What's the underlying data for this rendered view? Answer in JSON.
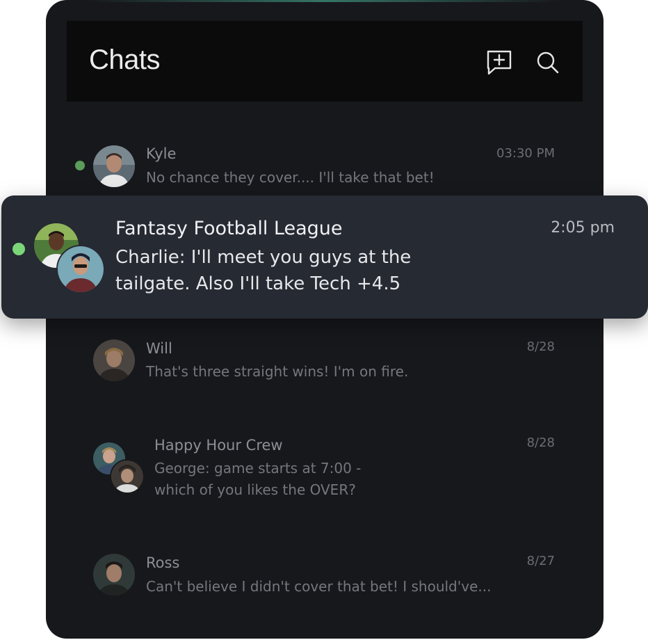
{
  "header": {
    "title": "Chats",
    "icons": [
      "new-chat-icon",
      "search-icon"
    ]
  },
  "chats": [
    {
      "name": "Kyle",
      "message": "No chance they cover....  I'll take that bet!",
      "time": "03:30 PM",
      "online": true
    },
    {
      "name": "Fantasy Football League",
      "message": "Charlie: I'll meet you guys at the\ntailgate. Also I'll take Tech +4.5",
      "time": "2:05 pm",
      "online": true,
      "highlighted": true
    },
    {
      "name": "Will",
      "message": "That's three straight wins!  I'm on fire.",
      "time": "8/28",
      "online": false
    },
    {
      "name": "Happy Hour Crew",
      "message": "George: game starts at 7:00 -\nwhich of you likes the OVER?",
      "time": "8/28",
      "online": false
    },
    {
      "name": "Ross",
      "message": "Can't believe I didn't cover that bet!  I should've...",
      "time": "8/27",
      "online": false
    }
  ],
  "colors": {
    "panel": "#17181c",
    "header": "#0b0b0c",
    "card": "#262a33",
    "online": "#7bd679"
  }
}
